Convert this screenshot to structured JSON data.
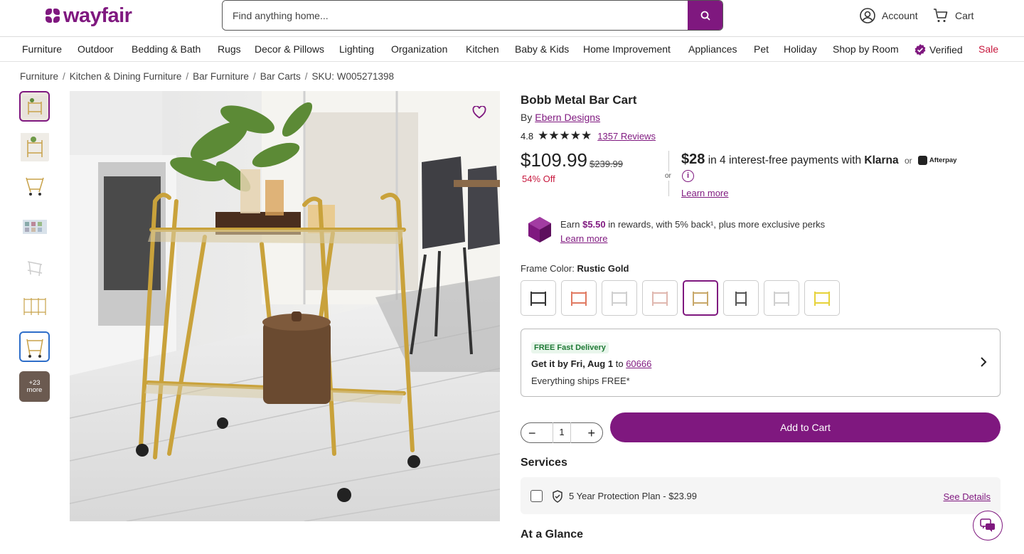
{
  "header": {
    "logo_text": "wayfair",
    "search_placeholder": "Find anything home...",
    "account_label": "Account",
    "cart_label": "Cart"
  },
  "categories": [
    "Furniture",
    "Outdoor",
    "Bedding & Bath",
    "Rugs",
    "Decor & Pillows",
    "Lighting",
    "Organization",
    "Kitchen",
    "Baby & Kids",
    "Home Improvement",
    "Appliances",
    "Pet",
    "Holiday",
    "Shop by Room",
    "Verified",
    "Sale"
  ],
  "breadcrumb": [
    "Furniture",
    "Kitchen & Dining Furniture",
    "Bar Furniture",
    "Bar Carts",
    "SKU: W005271398"
  ],
  "thumbnails": {
    "more_label": "+23 more"
  },
  "product": {
    "title": "Bobb Metal Bar Cart",
    "by_prefix": "By",
    "brand": "Ebern Designs",
    "rating": "4.8",
    "reviews": "1357 Reviews",
    "price": "$109.99",
    "was_price": "$239.99",
    "discount": "54% Off",
    "or_label": "or",
    "klarna_amount": "$28",
    "klarna_text": "in 4 interest-free payments with",
    "klarna_brand": "Klarna",
    "klarna_or": "or",
    "afterpay": "Afterpay",
    "learn_more": "Learn more",
    "rewards_earn": "Earn",
    "rewards_amount": "$5.50",
    "rewards_text": "in rewards, with 5% back¹, plus more exclusive perks",
    "rewards_learn": "Learn more",
    "frame_label": "Frame Color:",
    "frame_value": "Rustic Gold",
    "swatch_colors": [
      "#333333",
      "#e07a62",
      "#d8d8d8",
      "#e0b8b0",
      "#c8a86a",
      "#555555",
      "#cfcfcf",
      "#e6d23a"
    ]
  },
  "delivery": {
    "badge": "FREE Fast Delivery",
    "get_it": "Get it by Fri, Aug 1",
    "to": "to",
    "zip": "60666",
    "ships": "Everything ships FREE*"
  },
  "cart": {
    "quantity": "1",
    "add_to_cart": "Add to Cart"
  },
  "services": {
    "heading": "Services",
    "plan": "5 Year Protection Plan - $23.99",
    "see_details": "See Details"
  },
  "at_a_glance": "At a Glance",
  "colors": {
    "brand_purple": "#7f187f",
    "sale_red": "#c7173d"
  }
}
